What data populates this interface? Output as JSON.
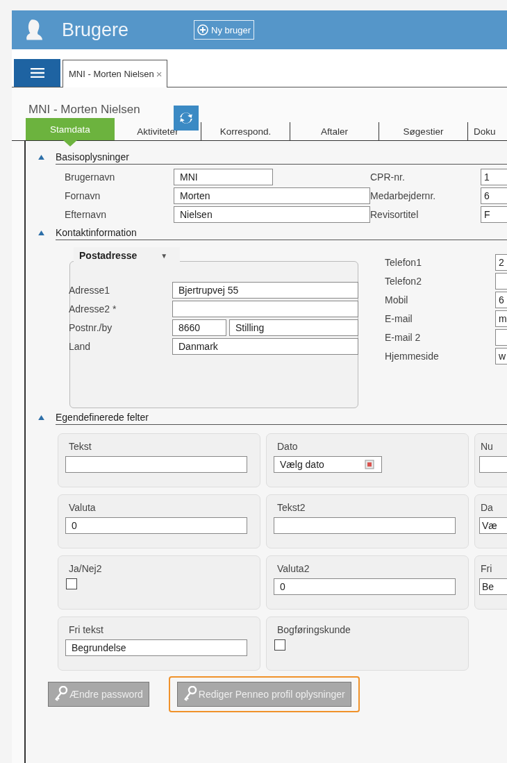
{
  "header": {
    "title": "Brugere",
    "new_button": "Ny bruger"
  },
  "doc_tabs": [
    {
      "label": "MNI - Morten Nielsen",
      "close": "×",
      "selected": true
    }
  ],
  "page_title": "MNI - Morten Nielsen",
  "tabs": [
    {
      "label": "Stamdata",
      "selected": true
    },
    {
      "label": "Aktiviteter",
      "selected": false
    },
    {
      "label": "Korrespond.",
      "selected": false
    },
    {
      "label": "Aftaler",
      "selected": false
    },
    {
      "label": "Søgestier",
      "selected": false
    },
    {
      "label": "Doku",
      "selected": false
    }
  ],
  "basis": {
    "title": "Basisoplysninger",
    "expanded": true,
    "left_fields": [
      {
        "label": "Brugernavn",
        "value": "MNI",
        "short": true
      },
      {
        "label": "Fornavn",
        "value": "Morten",
        "short": false
      },
      {
        "label": "Efternavn",
        "value": "Nielsen",
        "short": false
      }
    ],
    "right_fields": [
      {
        "label": "CPR-nr.",
        "value": "1"
      },
      {
        "label": "Medarbejdernr.",
        "value": "6"
      },
      {
        "label": "Revisortitel",
        "value": "F"
      }
    ]
  },
  "kontakt": {
    "title": "Kontaktinformation",
    "expanded": true,
    "address_group": {
      "title": "Postadresse",
      "caret": "▼",
      "fields": [
        {
          "label": "Adresse1",
          "values": [
            "Bjertrupvej 55"
          ]
        },
        {
          "label": "Adresse2 *"
        },
        {
          "label": "Postnr./by",
          "values": [
            "8660",
            "Stilling"
          ]
        },
        {
          "label": "Land",
          "values": [
            "Danmark"
          ]
        }
      ]
    },
    "right_fields": [
      {
        "label": "Telefon1",
        "value": "2"
      },
      {
        "label": "Telefon2"
      },
      {
        "label": "Mobil",
        "value": "6"
      },
      {
        "label": "E-mail",
        "value": "m"
      },
      {
        "label": "E-mail 2"
      },
      {
        "label": "Hjemmeside",
        "value": "w"
      }
    ]
  },
  "custom": {
    "title": "Egendefinerede felter",
    "expanded": true,
    "cards": [
      {
        "label": "Tekst",
        "kind": "text"
      },
      {
        "label": "Dato",
        "kind": "date",
        "value": "Vælg dato",
        "calendar_icon": true
      },
      {
        "label": "Nu",
        "kind": "text"
      },
      {
        "label": "Valuta",
        "kind": "text",
        "value": "0"
      },
      {
        "label": "Tekst2",
        "kind": "text"
      },
      {
        "label": "Da",
        "kind": "date",
        "value": "Væ"
      },
      {
        "label": "Ja/Nej2",
        "kind": "checkbox",
        "checked": false
      },
      {
        "label": "Valuta2",
        "kind": "text",
        "value": "0"
      },
      {
        "label": "Fri",
        "kind": "text",
        "value": "Be"
      },
      {
        "label": "Fri tekst",
        "kind": "text",
        "value": "Begrundelse"
      },
      {
        "label": "Bogføringskunde",
        "kind": "checkbox",
        "checked": false
      }
    ]
  },
  "buttons": [
    {
      "label": "Ændre password",
      "disabled": true,
      "highlighted": false
    },
    {
      "label": "Rediger Penneo profil oplysninger",
      "disabled": true,
      "highlighted": true
    }
  ]
}
